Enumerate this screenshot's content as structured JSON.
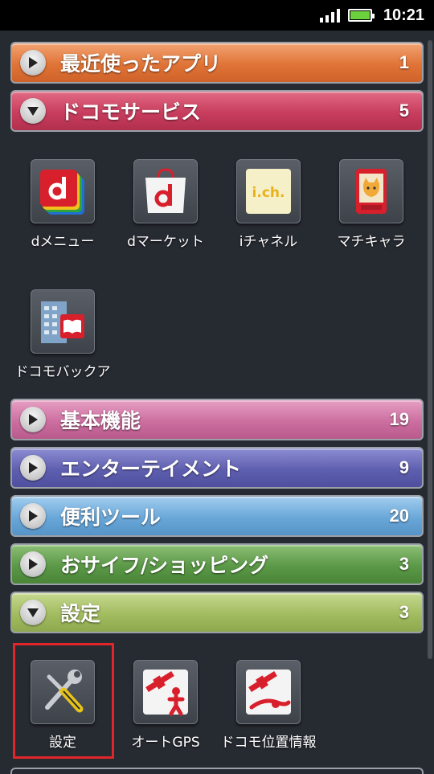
{
  "status_bar": {
    "time": "10:21",
    "icons": [
      "signal-icon",
      "battery-icon"
    ]
  },
  "categories": [
    {
      "label": "最近使ったアプリ",
      "count": "1",
      "expanded": false,
      "color": "#e07437"
    },
    {
      "label": "ドコモサービス",
      "count": "5",
      "expanded": true,
      "color": "#c83d5d"
    },
    {
      "label": "基本機能",
      "count": "19",
      "expanded": false,
      "color": "#cc6ea0"
    },
    {
      "label": "エンターテイメント",
      "count": "9",
      "expanded": false,
      "color": "#5f5fb0"
    },
    {
      "label": "便利ツール",
      "count": "20",
      "expanded": false,
      "color": "#6aa7d9"
    },
    {
      "label": "おサイフ/ショッピング",
      "count": "3",
      "expanded": false,
      "color": "#5b9847"
    },
    {
      "label": "設定",
      "count": "3",
      "expanded": true,
      "color": "#a2bc60"
    }
  ],
  "docomo_apps": [
    {
      "name": "dメニュー",
      "icon": "dmenu-icon"
    },
    {
      "name": "dマーケット",
      "icon": "dmarket-icon"
    },
    {
      "name": "iチャネル",
      "icon": "ichannel-icon"
    },
    {
      "name": "マチキャラ",
      "icon": "machichara-icon"
    },
    {
      "name": "ドコモバックア",
      "icon": "docomo-backup-icon"
    }
  ],
  "settings_apps": [
    {
      "name": "設定",
      "icon": "settings-tools-icon"
    },
    {
      "name": "オートGPS",
      "icon": "auto-gps-icon"
    },
    {
      "name": "ドコモ位置情報",
      "icon": "docomo-location-icon"
    }
  ]
}
